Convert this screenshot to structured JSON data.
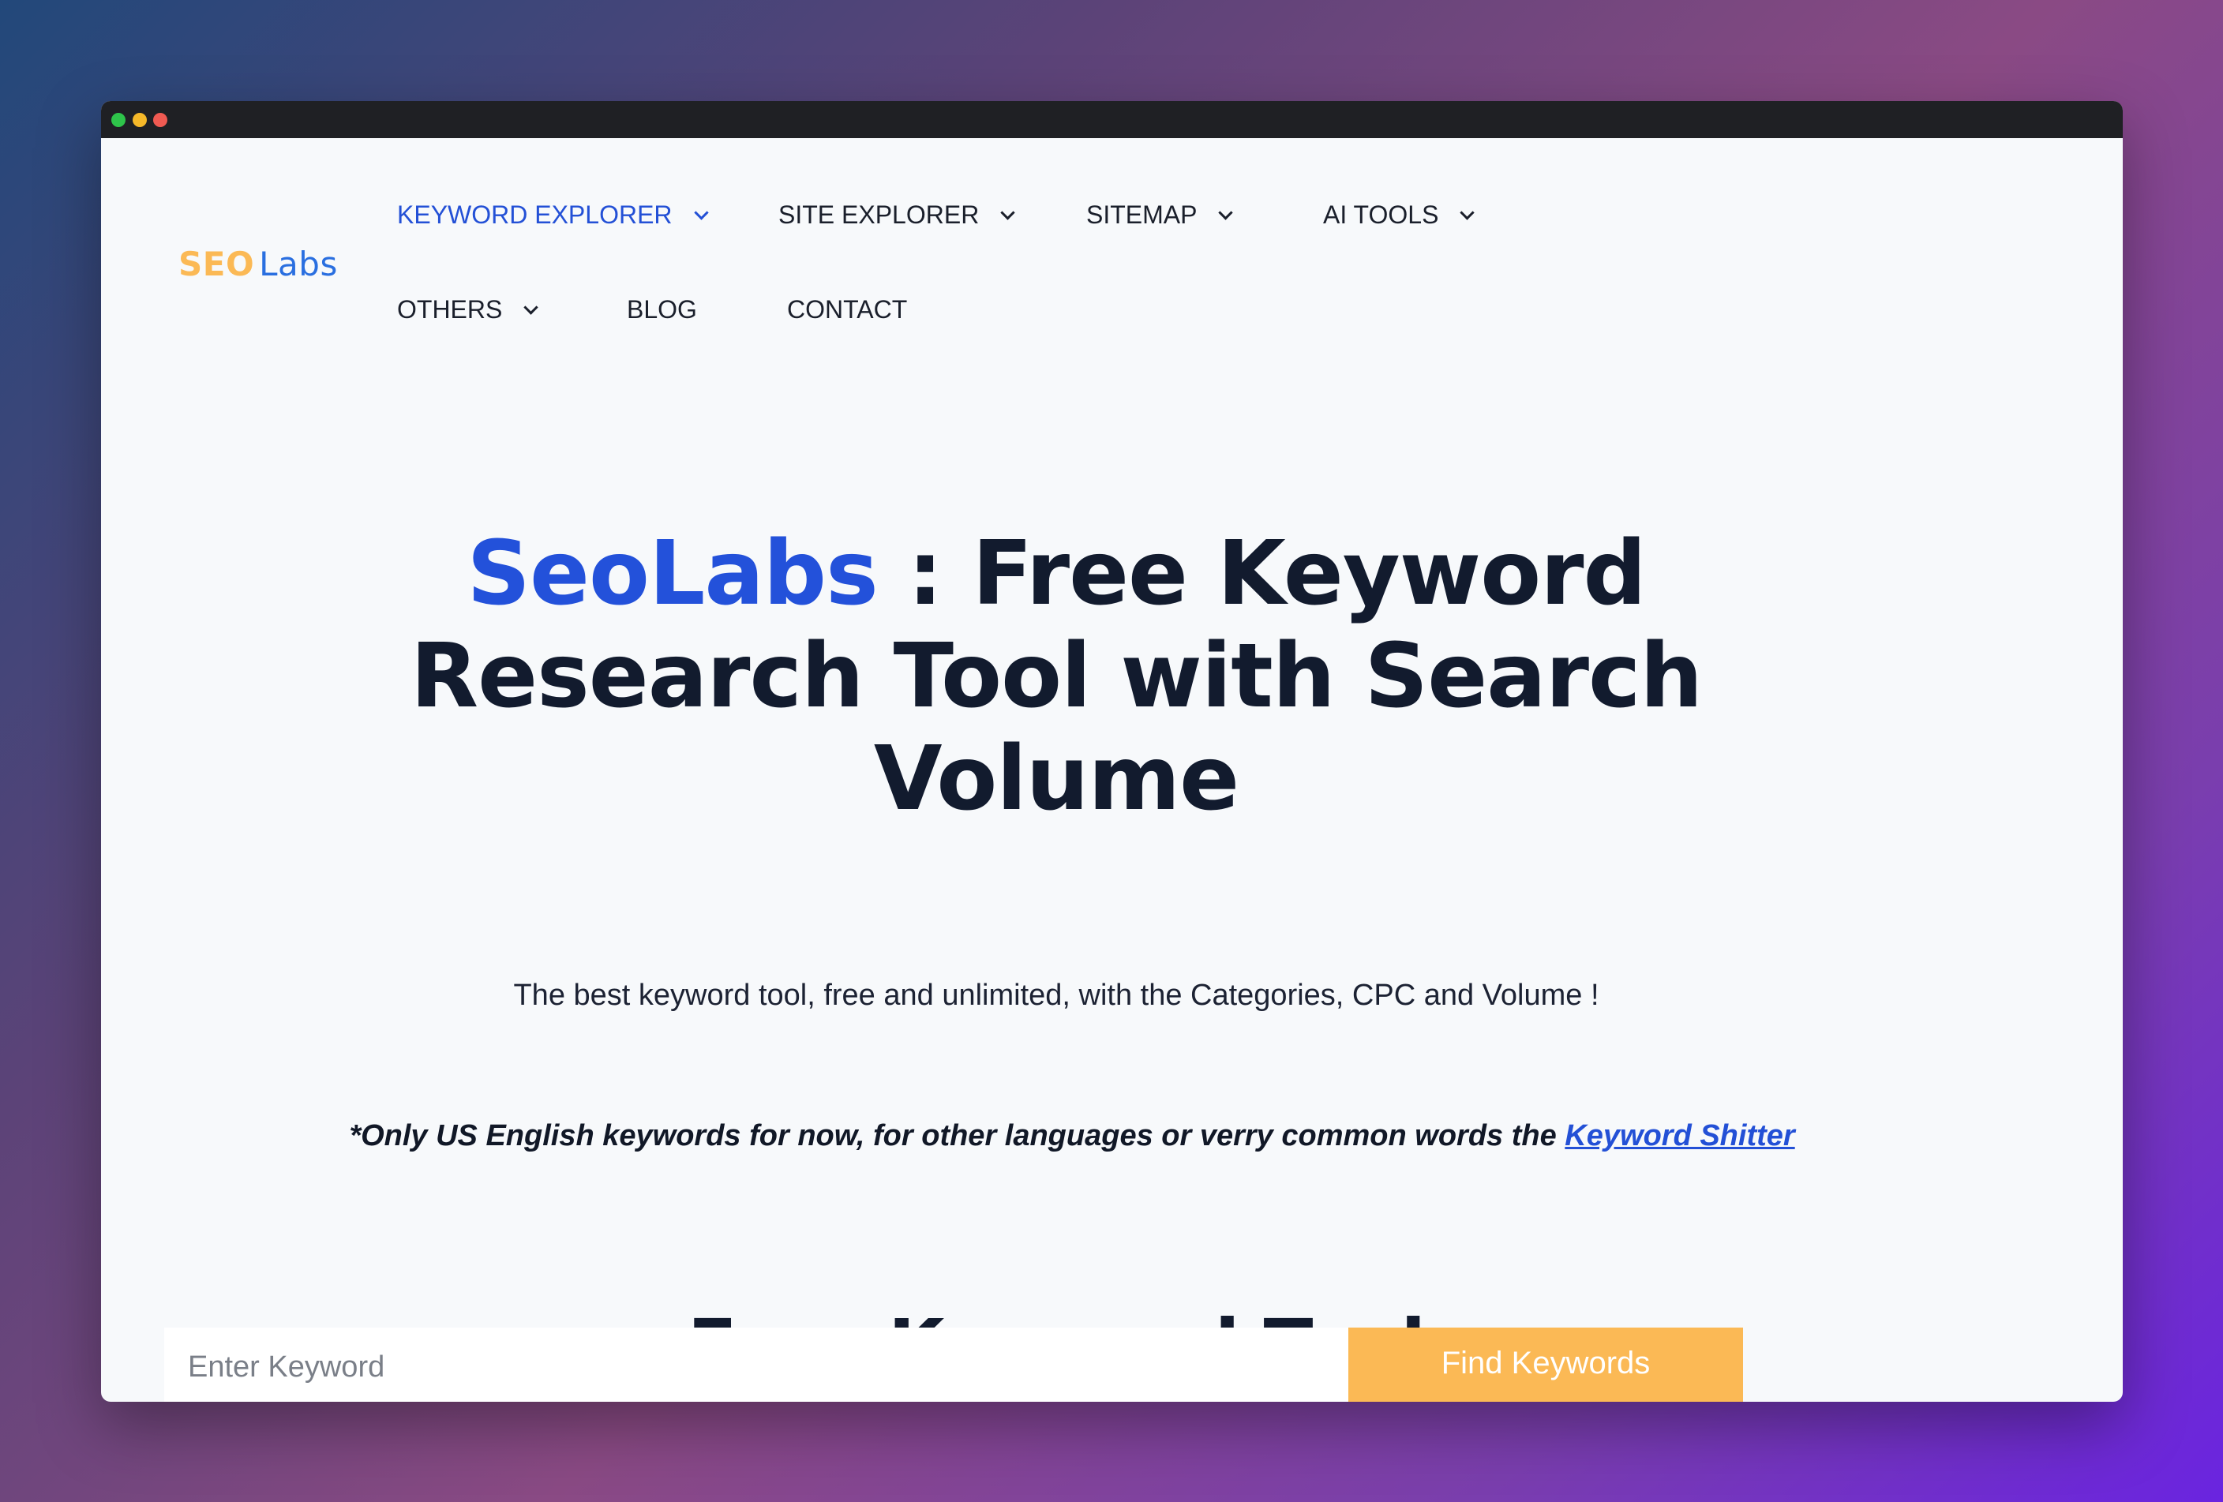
{
  "logo": {
    "seo": "SEO",
    "labs": "Labs"
  },
  "nav": {
    "keyword_explorer": "KEYWORD EXPLORER",
    "site_explorer": "SITE EXPLORER",
    "sitemap": "SITEMAP",
    "ai_tools": "AI TOOLS",
    "others": "OTHERS",
    "blog": "BLOG",
    "contact": "CONTACT"
  },
  "hero": {
    "brand": "SeoLabs",
    "title_rest": " : Free Keyword Research Tool with Search Volume"
  },
  "subtitle": "The best keyword tool, free and unlimited, with the Categories, CPC and Volume !",
  "note": {
    "text": "*Only US English keywords for now, for other languages or verry common words the ",
    "link": "Keyword Shitter"
  },
  "tool": {
    "title": "Free Keyword Tool",
    "input_placeholder": "Enter Keyword",
    "button": "Find Keywords"
  },
  "colors": {
    "accent_blue": "#2350d6",
    "accent_orange": "#fbb955",
    "heading_dark": "#121b2e"
  }
}
